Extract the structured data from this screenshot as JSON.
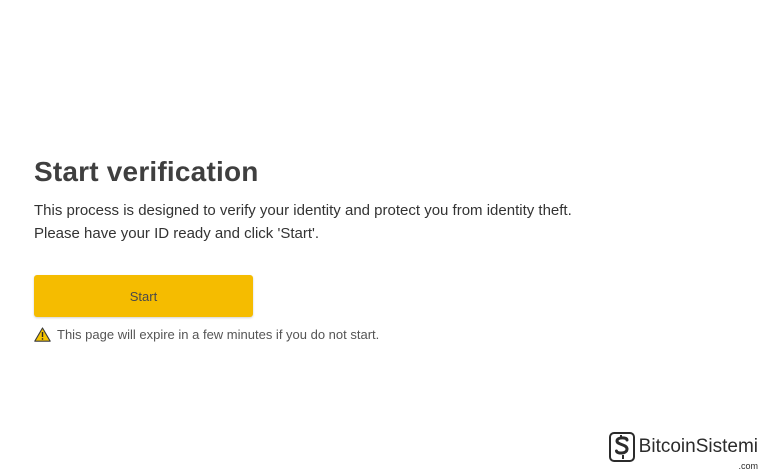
{
  "page": {
    "title": "Start verification",
    "description_lines": [
      "This process is designed to verify your identity and protect you from identity theft.",
      "Please have your ID ready and click 'Start'."
    ]
  },
  "actions": {
    "start_label": "Start"
  },
  "notice": {
    "icon": "warning-triangle-icon",
    "text": "This page will expire in a few minutes if you do not start."
  },
  "watermark": {
    "text": "BitcoinSistemi",
    "sub": ".com"
  },
  "colors": {
    "button": "#f5bc00",
    "warning_icon": "#f5c400",
    "text": "#333333"
  }
}
